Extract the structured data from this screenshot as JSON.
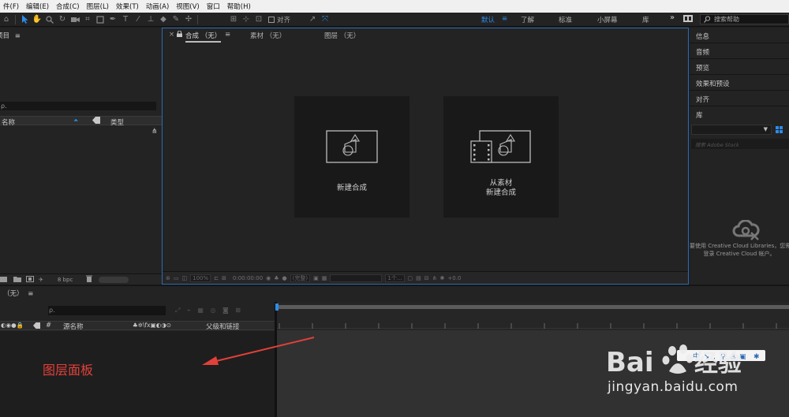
{
  "menu": {
    "items": [
      "件(F)",
      "编辑(E)",
      "合成(C)",
      "图层(L)",
      "效果(T)",
      "动画(A)",
      "视图(V)",
      "窗口",
      "帮助(H)"
    ]
  },
  "toolbar": {
    "align_label": "对齐",
    "workspaces": [
      {
        "label": "默认",
        "active": true
      },
      {
        "label": "了解",
        "active": false
      },
      {
        "label": "标准",
        "active": false
      },
      {
        "label": "小屏幕",
        "active": false
      },
      {
        "label": "库",
        "active": false
      }
    ],
    "more": "»",
    "search_placeholder": "搜索帮助"
  },
  "project": {
    "title": "项目",
    "search_icon_text": "ρ.",
    "col_name": "名称",
    "col_type": "类型",
    "bpc": "8 bpc"
  },
  "viewer": {
    "tabs": [
      {
        "label": "合成 （无）",
        "active": true
      },
      {
        "label": "素材 （无）",
        "active": false
      },
      {
        "label": "图层 （无）",
        "active": false
      }
    ],
    "new_comp": "新建合成",
    "from_footage_line1": "从素材",
    "from_footage_line2": "新建合成",
    "bottom": {
      "zoom": "100%",
      "timecode": "0:00:00:00",
      "resolution": "(完整)",
      "view": "1个...",
      "offset": "+0.0"
    }
  },
  "right_panels": {
    "items": [
      "信息",
      "音频",
      "预览",
      "效果和预设",
      "对齐",
      "库"
    ],
    "lib_search_placeholder": "搜索 Adobe Stock",
    "lib_msg_line1": "要使用 Creative Cloud Libraries，您需",
    "lib_msg_line2": "登录 Creative Cloud 帐户。"
  },
  "timeline": {
    "tab": "（无）",
    "search_icon_text": "ρ.",
    "col_source": "源名称",
    "col_parent": "父级和链接",
    "col_hash": "#"
  },
  "annotation": {
    "text": "图层面板",
    "color": "#e2403a"
  },
  "watermark": {
    "url": "jingyan.baidu.com"
  },
  "colors": {
    "accent": "#2d8ceb",
    "panel": "#232323",
    "viewer_border": "#2d6ab3"
  }
}
